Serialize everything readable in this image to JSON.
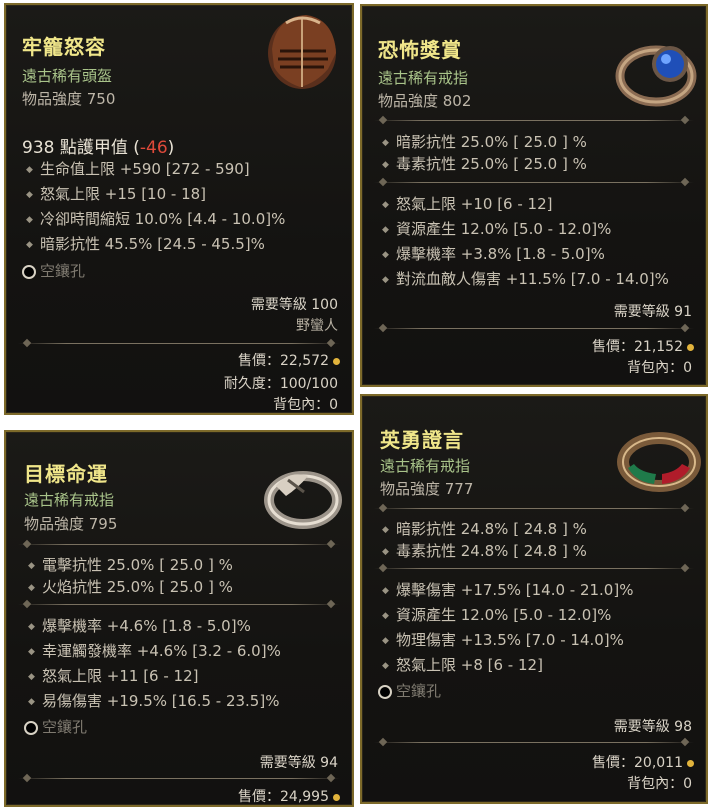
{
  "items": [
    {
      "name": "牢籠怒容",
      "type": "遠古稀有頭盔",
      "power": "物品強度 750",
      "armor_label": "938 點護甲值 (",
      "armor_diff": "-46",
      "armor_close": ")",
      "affixes": [
        "生命值上限 +590 [272 - 590]",
        "怒氣上限 +15 [10 - 18]",
        "冷卻時間縮短 10.0% [4.4 - 10.0]%",
        "暗影抗性 45.5% [24.5 - 45.5]%"
      ],
      "socket": "空鑲孔",
      "req_level": "需要等級 100",
      "req_class": "野蠻人",
      "price": "售價：22,572",
      "durability": "耐久度：100/100",
      "inventory": "背包內：0",
      "icon": "helmet-icon"
    },
    {
      "name": "恐怖獎賞",
      "type": "遠古稀有戒指",
      "power": "物品強度 802",
      "implicits": [
        "暗影抗性 25.0%  [ 25.0 ] %",
        "毒素抗性 25.0%  [ 25.0 ] %"
      ],
      "affixes": [
        "怒氣上限 +10 [6 - 12]",
        "資源產生 12.0% [5.0 - 12.0]%",
        "爆擊機率 +3.8% [1.8 - 5.0]%",
        "對流血敵人傷害 +11.5% [7.0 - 14.0]%"
      ],
      "req_level": "需要等級 91",
      "price": "售價：21,152",
      "inventory": "背包內：0",
      "icon": "ring-blue-gem-icon"
    },
    {
      "name": "目標命運",
      "type": "遠古稀有戒指",
      "power": "物品強度 795",
      "implicits": [
        "電擊抗性 25.0%  [ 25.0 ] %",
        "火焰抗性 25.0%  [ 25.0 ] %"
      ],
      "affixes": [
        "爆擊機率 +4.6% [1.8 - 5.0]%",
        "幸運觸發機率 +4.6% [3.2 - 6.0]%",
        "怒氣上限 +11 [6 - 12]",
        "易傷傷害 +19.5% [16.5 - 23.5]%"
      ],
      "socket": "空鑲孔",
      "req_level": "需要等級 94",
      "price": "售價：24,995",
      "icon": "ring-silver-icon"
    },
    {
      "name": "英勇證言",
      "type": "遠古稀有戒指",
      "power": "物品強度 777",
      "implicits": [
        "暗影抗性 24.8%  [ 24.8 ] %",
        "毒素抗性 24.8%  [ 24.8 ] %"
      ],
      "affixes": [
        "爆擊傷害 +17.5% [14.0 - 21.0]%",
        "資源產生 12.0% [5.0 - 12.0]%",
        "物理傷害 +13.5% [7.0 - 14.0]%",
        "怒氣上限 +8 [6 - 12]"
      ],
      "socket": "空鑲孔",
      "req_level": "需要等級 98",
      "price": "售價：20,011",
      "inventory": "背包內：0",
      "icon": "ring-red-green-gem-icon"
    }
  ],
  "colors": {
    "name": "#f0e68a",
    "type": "#a9c48a",
    "negative": "#e04a3a",
    "border": "#7d6a2a",
    "gold": "#e2b43c"
  }
}
